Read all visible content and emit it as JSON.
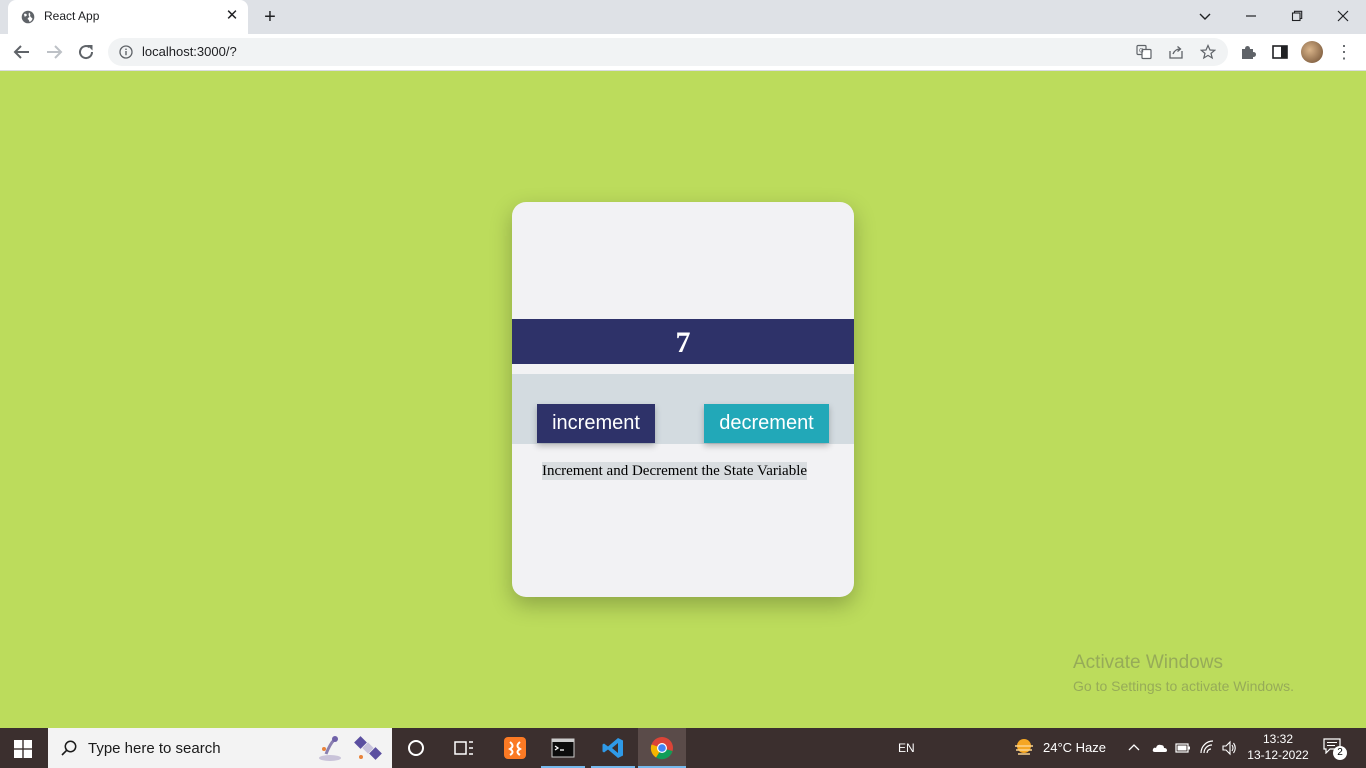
{
  "browser": {
    "tab_title": "React App",
    "url": "localhost:3000/?"
  },
  "page": {
    "background_color": "#bcdc5c",
    "counter_value": "7",
    "increment_label": "increment",
    "decrement_label": "decrement",
    "caption": "Increment and Decrement the State Variable",
    "colors": {
      "primary": "#2e3269",
      "secondary": "#22a8b8",
      "card": "#f2f2f4"
    }
  },
  "watermark": {
    "line1": "Activate Windows",
    "line2": "Go to Settings to activate Windows."
  },
  "taskbar": {
    "search_placeholder": "Type here to search",
    "language": "EN",
    "weather": "24°C  Haze",
    "time": "13:32",
    "date": "13-12-2022",
    "notification_count": "2"
  }
}
